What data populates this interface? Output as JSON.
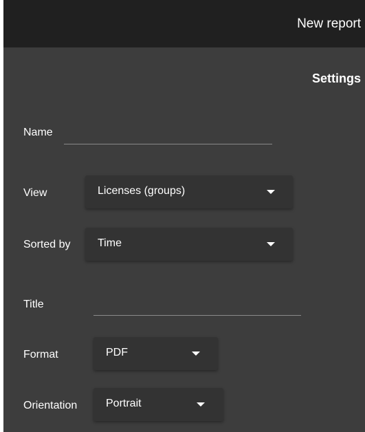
{
  "header": {
    "title": "New report"
  },
  "settings": {
    "title": "Settings",
    "name": {
      "label": "Name",
      "value": ""
    },
    "view": {
      "label": "View",
      "value": "Licenses (groups)"
    },
    "sorted_by": {
      "label": "Sorted by",
      "value": "Time"
    },
    "report_title": {
      "label": "Title",
      "value": ""
    },
    "format": {
      "label": "Format",
      "value": "PDF"
    },
    "orientation": {
      "label": "Orientation",
      "value": "Portrait"
    }
  },
  "icons": {
    "dropdown": "chevron-down-icon"
  },
  "colors": {
    "header_bg": "#202020",
    "panel_bg": "#3d3d3d",
    "dropdown_bg": "#333333",
    "text": "#ffffff",
    "underline": "#8a8a8a"
  }
}
